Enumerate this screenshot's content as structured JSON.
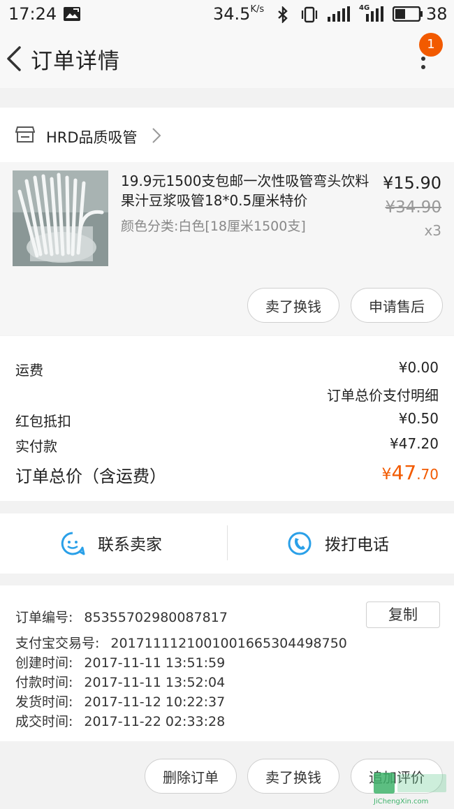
{
  "status_bar": {
    "time": "17:24",
    "speed": "34.5",
    "speed_unit": "K/s",
    "network": "4G",
    "battery": "38"
  },
  "header": {
    "title": "订单详情",
    "badge_count": "1"
  },
  "shop": {
    "name": "HRD品质吸管"
  },
  "product": {
    "title": "19.9元1500支包邮一次性吸管弯头饮料果汁豆浆吸管18*0.5厘米特价",
    "sku": "颜色分类:白色[18厘米1500支]",
    "price": "¥15.90",
    "original_price": "¥34.90",
    "quantity": "x3",
    "sell_label": "卖了换钱",
    "aftersale_label": "申请售后"
  },
  "fees": {
    "shipping_label": "运费",
    "shipping_value": "¥0.00",
    "payment_detail_label": "订单总价支付明细",
    "redpacket_label": "红包抵扣",
    "redpacket_value": "¥0.50",
    "paid_label": "实付款",
    "paid_value": "¥47.20",
    "total_label": "订单总价（含运费）",
    "total_currency": "¥",
    "total_int": "47",
    "total_dec": ".70"
  },
  "contact": {
    "seller_label": "联系卖家",
    "call_label": "拨打电话"
  },
  "order_info": {
    "order_no_label": "订单编号:",
    "order_no": "85355702980087817",
    "copy_label": "复制",
    "alipay_label": "支付宝交易号:",
    "alipay_no": "2017111121001001665304498750",
    "created_label": "创建时间:",
    "created": "2017-11-11 13:51:59",
    "paid_label": "付款时间:",
    "paid": "2017-11-11 13:52:04",
    "shipped_label": "发货时间:",
    "shipped": "2017-11-12 10:22:37",
    "done_label": "成交时间:",
    "done": "2017-11-22 02:33:28"
  },
  "bottom_actions": {
    "delete_label": "删除订单",
    "sell_label": "卖了换钱",
    "review_label": "追加评价"
  },
  "watermark": {
    "text": "JiChengXin.com"
  },
  "colors": {
    "accent": "#f25a00",
    "icon_blue": "#2aa0e8"
  }
}
